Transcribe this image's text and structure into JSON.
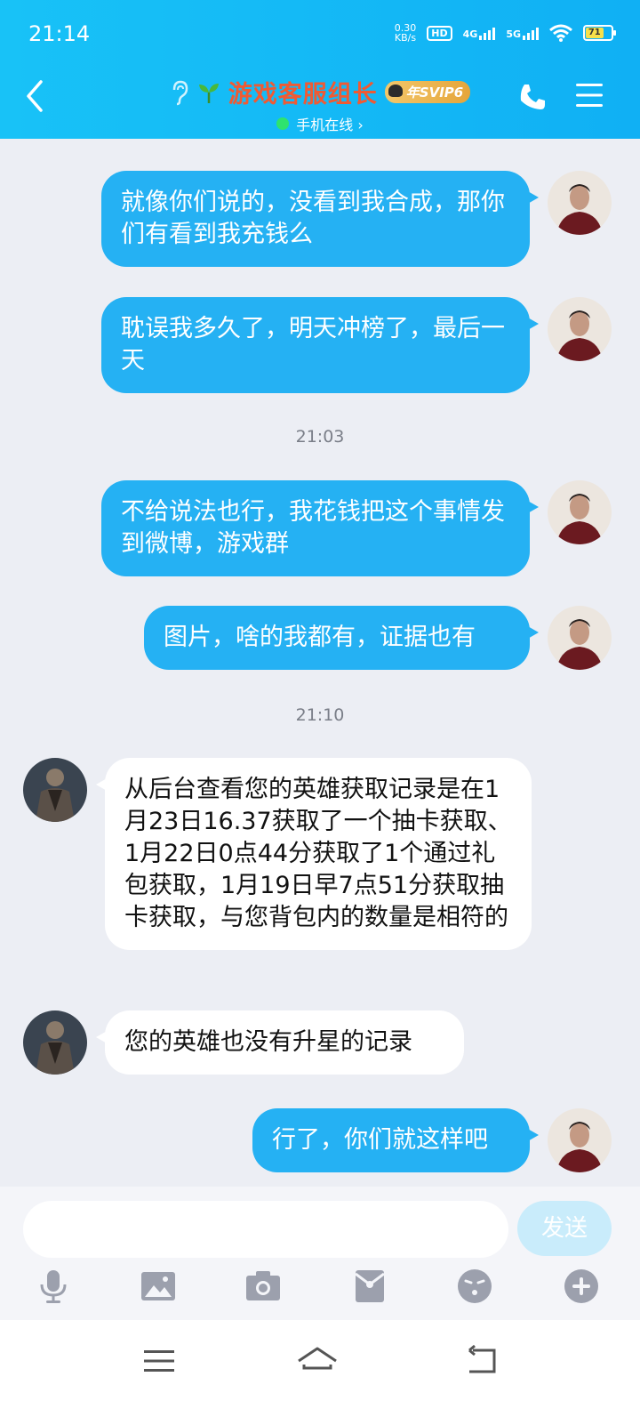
{
  "status": {
    "time": "21:14",
    "speed_value": "0.30",
    "speed_unit": "KB/s",
    "hd": "HD",
    "net1": "4G",
    "net2": "5G",
    "battery": "71"
  },
  "header": {
    "title": "游戏客服组长",
    "badge": "年SVIP6",
    "presence": "手机在线 ›"
  },
  "messages": [
    {
      "text": "就像你们说的，没看到我合成，那你们有看到我充钱么"
    },
    {
      "text": "耽误我多久了，明天冲榜了，最后一天"
    },
    {
      "text": "不给说法也行，我花钱把这个事情发到微博，游戏群"
    },
    {
      "text": "图片，啥的我都有，证据也有"
    },
    {
      "text": "从后台查看您的英雄获取记录是在1月23日16.37获取了一个抽卡获取、1月22日0点44分获取了1个通过礼包获取，1月19日早7点51分获取抽卡获取，与您背包内的数量是相符的"
    },
    {
      "text": "您的英雄也没有升星的记录"
    },
    {
      "text": "行了，你们就这样吧"
    }
  ],
  "timestamps": [
    "21:03",
    "21:10"
  ],
  "input": {
    "placeholder": "",
    "send_label": "发送"
  },
  "colors": {
    "header": "#18c2f7",
    "my_bubble": "#25b1f3",
    "title": "#f05a33"
  }
}
